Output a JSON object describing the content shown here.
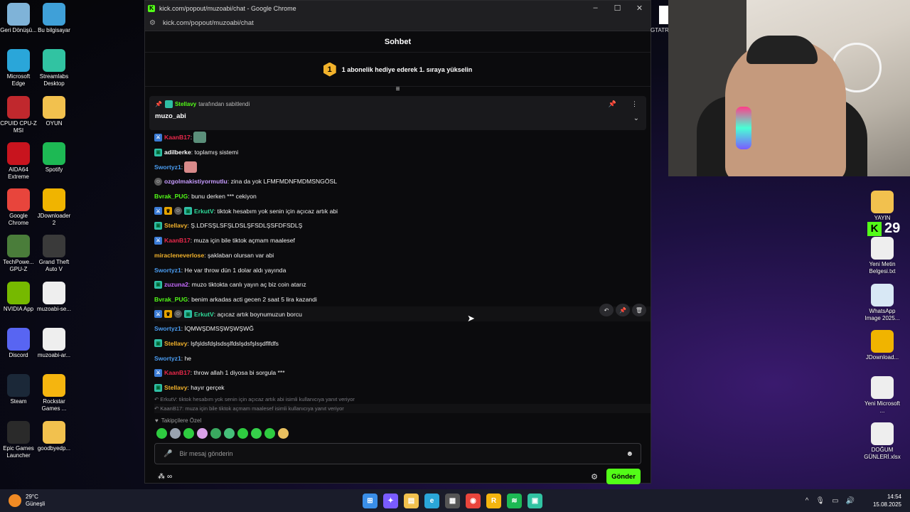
{
  "desktop_left": [
    [
      {
        "label": "Geri Dönüşü...",
        "icon": "recycle-bin-icon",
        "color": "#7fb3d8"
      },
      {
        "label": "Microsoft Edge",
        "icon": "edge-icon",
        "color": "#2aa6d9"
      },
      {
        "label": "CPUID CPU-Z MSI",
        "icon": "cpuz-icon",
        "color": "#c0282d"
      },
      {
        "label": "AIDA64 Extreme",
        "icon": "aida64-icon",
        "color": "#c8141e"
      },
      {
        "label": "Google Chrome",
        "icon": "chrome-icon",
        "color": "#e8453c"
      },
      {
        "label": "TechPowe... GPU-Z",
        "icon": "gpuz-icon",
        "color": "#4a7d3a"
      },
      {
        "label": "NVIDIA App",
        "icon": "nvidia-icon",
        "color": "#76b900"
      },
      {
        "label": "Discord",
        "icon": "discord-icon",
        "color": "#5865f2"
      },
      {
        "label": "Steam",
        "icon": "steam-icon",
        "color": "#1b2838"
      },
      {
        "label": "Epic Games Launcher",
        "icon": "epic-icon",
        "color": "#2a2a2a"
      }
    ],
    [
      {
        "label": "Bu bilgisayar",
        "icon": "computer-icon",
        "color": "#3fa0d8"
      },
      {
        "label": "Streamlabs Desktop",
        "icon": "streamlabs-icon",
        "color": "#31c3a2"
      },
      {
        "label": "OYUN",
        "icon": "folder-icon",
        "color": "#f2c14e"
      },
      {
        "label": "Spotify",
        "icon": "spotify-icon",
        "color": "#1db954"
      },
      {
        "label": "JDownloader 2",
        "icon": "jdownloader-icon",
        "color": "#f0b400"
      },
      {
        "label": "Grand Theft Auto V",
        "icon": "gta-icon",
        "color": "#3a3a3a"
      },
      {
        "label": "muzoabi-se...",
        "icon": "video-file-icon",
        "color": "#eeeeee"
      },
      {
        "label": "muzoabi-ar...",
        "icon": "video-file-icon",
        "color": "#eeeeee"
      },
      {
        "label": "Rockstar Games ...",
        "icon": "rockstar-icon",
        "color": "#f5b50f"
      },
      {
        "label": "goodbyedp...",
        "icon": "folder-icon",
        "color": "#f2c14e"
      }
    ]
  ],
  "desktop_right": [
    {
      "label": "YAYIN",
      "icon": "folder-icon",
      "color": "#f2c14e"
    },
    {
      "label": "Yeni Metin Belgesi.txt",
      "icon": "text-file-icon",
      "color": "#eeeeee"
    },
    {
      "label": "WhatsApp Image 2025...",
      "icon": "image-file-icon",
      "color": "#d8e8f5"
    },
    {
      "label": "JDownload...",
      "icon": "jdownloader-icon",
      "color": "#f0b400"
    },
    {
      "label": "Yeni Microsoft ...",
      "icon": "doc-file-icon",
      "color": "#eeeeee"
    },
    {
      "label": "DOĞUM GÜNLERİ.xlsx",
      "icon": "excel-file-icon",
      "color": "#eeeeee"
    }
  ],
  "window": {
    "title": "kick.com/popout/muzoabi/chat - Google Chrome",
    "url": "kick.com/popout/muzoabi/chat"
  },
  "chat": {
    "header": "Sohbet",
    "promo_rank": "1",
    "promo": "1 abonelik hediye ederek 1. sıraya yükselin",
    "pinned": {
      "by_user": "Stellavy",
      "by_text": "tarafından sabitlendi",
      "message": "muzo_abi"
    },
    "messages": [
      {
        "user": "KaanB17",
        "color": "#e8284a",
        "badges": [
          "blue"
        ],
        "text": "",
        "emote": "#5b8f7a"
      },
      {
        "user": "adilberke",
        "color": "#ffffff",
        "badges": [
          "teal"
        ],
        "text": ": toplamış sistemi"
      },
      {
        "user": "Swortyz1",
        "color": "#4a9cf0",
        "badges": [],
        "text": "",
        "emote": "#d88a8a"
      },
      {
        "user": "ozgolmakistiyormutlu",
        "color": "#c79cff",
        "badges": [
          "grey"
        ],
        "text": ": zina da yok LFMFMDNFMDMSNGÖSL"
      },
      {
        "user": "Bvrak_PUG",
        "color": "#53fc18",
        "badges": [],
        "text": ": bunu derken *** cekiyon"
      },
      {
        "user": "ErkutV",
        "color": "#2fdc9a",
        "badges": [
          "blue",
          "gold",
          "grey",
          "teal"
        ],
        "text": ": tiktok hesabım yok senin için açıcaz artık abi"
      },
      {
        "user": "Stellavy",
        "color": "#f2b22b",
        "badges": [
          "teal"
        ],
        "text": ": Ş.LDFSŞLSFŞLDSLŞFSDLŞSFDFSDLŞ"
      },
      {
        "reply": "ErkutV: tiktok hesabım yok senin için açıcaz artık abi isimli kullanıcıya yanıt veriyor"
      },
      {
        "user": "KaanB17",
        "color": "#e8284a",
        "badges": [
          "blue"
        ],
        "text": ": muza için bile tiktok açmam maalesef"
      },
      {
        "user": "miracleneverlose",
        "color": "#f2b22b",
        "badges": [],
        "text": ": şaklaban olursan var abi"
      },
      {
        "user": "Swortyz1",
        "color": "#4a9cf0",
        "badges": [],
        "text": ": He var throw dün 1 dolar aldı yayında"
      },
      {
        "user": "zuzuna2",
        "color": "#c76bff",
        "badges": [
          "teal"
        ],
        "text": ": muzo tiktokta canlı yayın aç biz coin atarız"
      },
      {
        "user": "Bvrak_PUG",
        "color": "#53fc18",
        "badges": [],
        "text": ": benim arkadas acti gecen 2 saat 5 lira kazandi"
      },
      {
        "reply": "KaanB17: muza için bile tiktok açmam maalesef isimli kullanıcıya yanıt veriyor",
        "highlight": true
      },
      {
        "user": "ErkutV",
        "color": "#2fdc9a",
        "badges": [
          "blue",
          "gold",
          "grey",
          "teal"
        ],
        "text": ": açıcaz artık boynumuzun borcu",
        "highlight": true
      },
      {
        "user": "Swortyz1",
        "color": "#4a9cf0",
        "badges": [],
        "text": ": İQMWŞDMSŞWŞWŞWĞ"
      },
      {
        "user": "Stellavy",
        "color": "#f2b22b",
        "badges": [
          "teal"
        ],
        "text": ": lşfşldsfdşlsdsşlfdslşdsfşlsşdflfdfs"
      },
      {
        "user": "Swortyz1",
        "color": "#4a9cf0",
        "badges": [],
        "text": ": he"
      },
      {
        "user": "KaanB17",
        "color": "#e8284a",
        "badges": [
          "blue"
        ],
        "text": ": throw allah 1 diyosa bi sorgula ***"
      },
      {
        "user": "Stellavy",
        "color": "#f2b22b",
        "badges": [
          "teal"
        ],
        "text": ": hayır gerçek"
      }
    ],
    "followers_label": "Takipçilere Özel",
    "emote_colors": [
      "#2ecc40",
      "#9aa3b0",
      "#2ecc40",
      "#d9a0e8",
      "#3aa860",
      "#45c07a",
      "#2ecc40",
      "#36d04a",
      "#2ecc40",
      "#e8c060"
    ],
    "input_placeholder": "Bir mesaj gönderin",
    "send_label": "Gönder",
    "footer_symbol": "∞"
  },
  "overlay": {
    "gtatr": "GTATR",
    "counter": "29"
  },
  "taskbar": {
    "temp": "29°C",
    "weather": "Güneşli",
    "time": "14:54",
    "date": "15.08.2025",
    "apps": [
      {
        "name": "start-icon",
        "color": "#3a8ee8",
        "glyph": "⊞"
      },
      {
        "name": "copilot-icon",
        "color": "#7a5cff",
        "glyph": "✦"
      },
      {
        "name": "file-explorer-icon",
        "color": "#f2c14e",
        "glyph": "▤"
      },
      {
        "name": "edge-icon",
        "color": "#2aa6d9",
        "glyph": "e"
      },
      {
        "name": "store-icon",
        "color": "#555555",
        "glyph": "▦"
      },
      {
        "name": "chrome-icon",
        "color": "#e8453c",
        "glyph": "◉"
      },
      {
        "name": "rockstar-icon",
        "color": "#f5b50f",
        "glyph": "R"
      },
      {
        "name": "spotify-icon",
        "color": "#1db954",
        "glyph": "≋"
      },
      {
        "name": "streamlabs-icon",
        "color": "#31c3a2",
        "glyph": "▣"
      }
    ]
  }
}
